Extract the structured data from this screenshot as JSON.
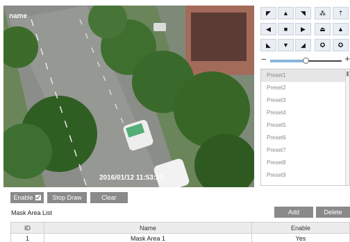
{
  "video": {
    "camera_name": "name",
    "timestamp": "2016/01/12  11:53:20"
  },
  "ptz": {
    "buttons": [
      {
        "name": "pan-up-left-icon",
        "glyph": "◤"
      },
      {
        "name": "pan-up-icon",
        "glyph": "▲"
      },
      {
        "name": "pan-up-right-icon",
        "glyph": "◥"
      },
      {
        "name": "iris-icon",
        "glyph": "⁂"
      },
      {
        "name": "zoom-icon",
        "glyph": "⇡"
      },
      {
        "name": "pan-left-icon",
        "glyph": "◀"
      },
      {
        "name": "pan-stop-icon",
        "glyph": "■"
      },
      {
        "name": "pan-right-icon",
        "glyph": "▶"
      },
      {
        "name": "focus-icon",
        "glyph": "⏏"
      },
      {
        "name": "brightness-icon",
        "glyph": "▲"
      },
      {
        "name": "pan-down-left-icon",
        "glyph": "◣"
      },
      {
        "name": "pan-down-icon",
        "glyph": "▼"
      },
      {
        "name": "pan-down-right-icon",
        "glyph": "◢"
      },
      {
        "name": "aperture-icon",
        "glyph": "✪"
      },
      {
        "name": "light-icon",
        "glyph": "✪"
      }
    ],
    "zoom_minus": "−",
    "zoom_plus": "+",
    "speed_level": 0.5
  },
  "presets": {
    "items": [
      "Preset1",
      "Preset2",
      "Preset3",
      "Preset4",
      "Preset5",
      "Preset6",
      "Preset7",
      "Preset8",
      "Preset9"
    ],
    "selected_index": 0
  },
  "controls": {
    "enable_label": "Enable",
    "stop_draw_label": "Stop Draw",
    "clear_label": "Clear",
    "add_label": "Add",
    "delete_label": "Delete"
  },
  "mask_list": {
    "title": "Mask Area List",
    "columns": {
      "id": "ID",
      "name": "Name",
      "enable": "Enable"
    },
    "rows": [
      {
        "id": "1",
        "name": "Mask Area 1",
        "enable": "Yes"
      }
    ]
  }
}
